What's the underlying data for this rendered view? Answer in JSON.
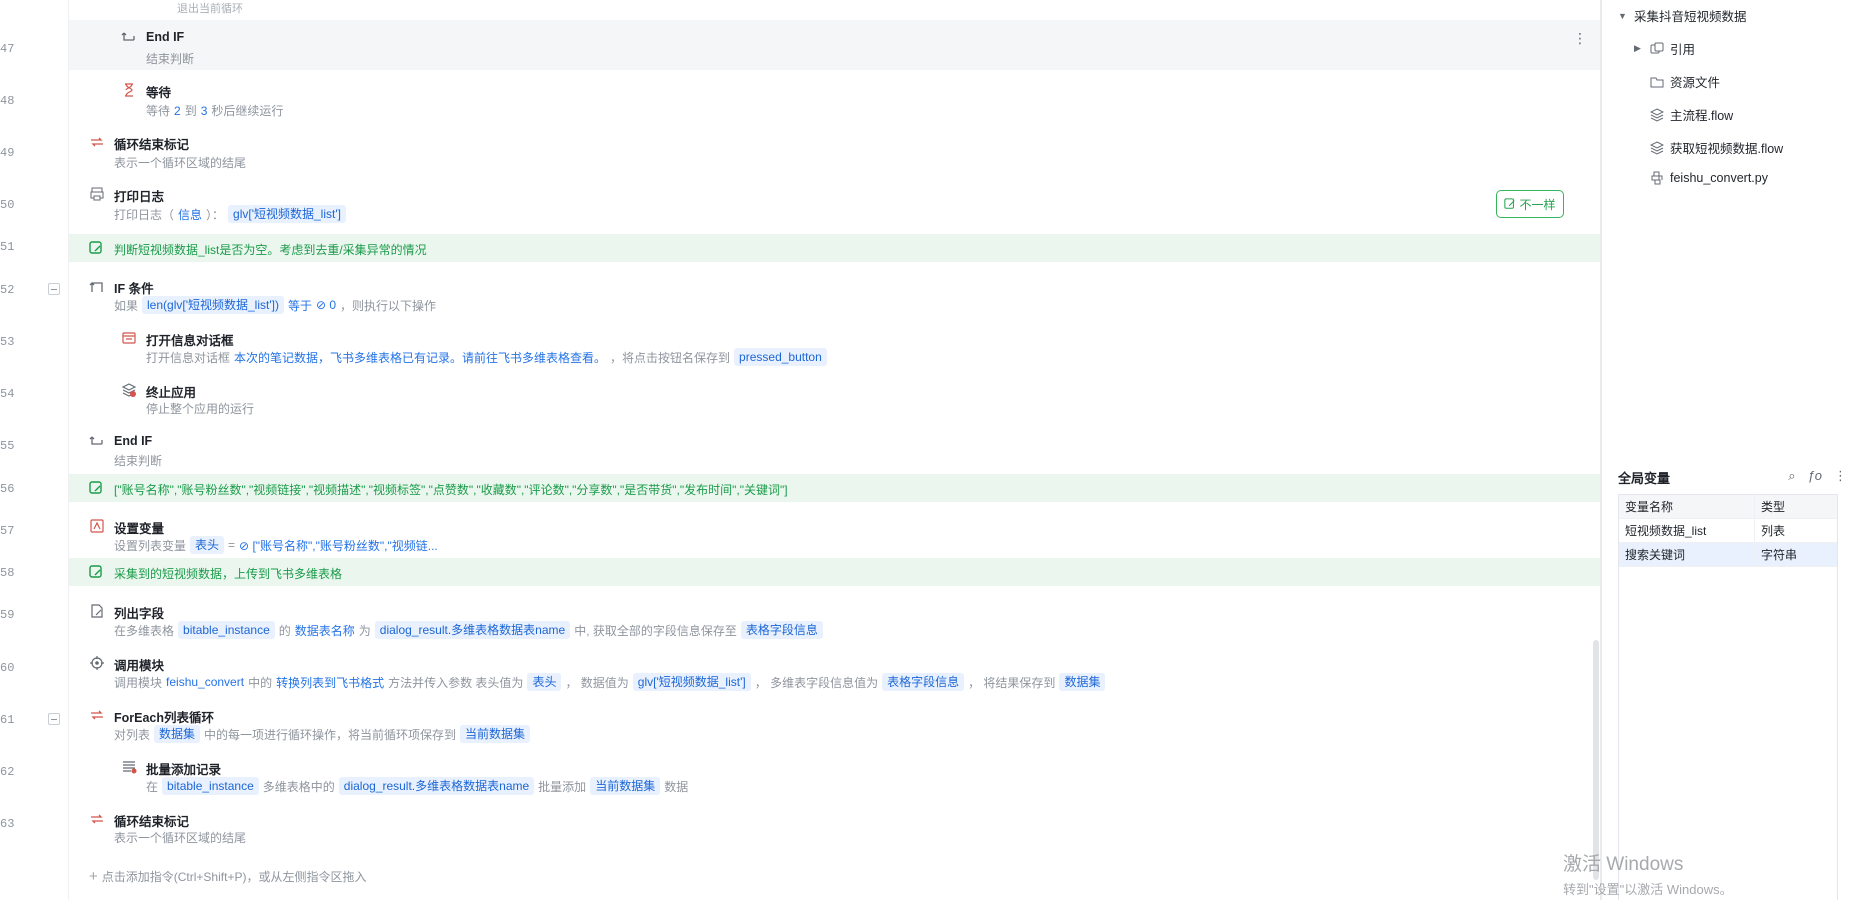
{
  "line_numbers": [
    "47",
    "48",
    "49",
    "50",
    "51",
    "52",
    "53",
    "54",
    "55",
    "56",
    "57",
    "58",
    "59",
    "60",
    "61",
    "62",
    "63"
  ],
  "top_cut_text": "退出当前循环",
  "rows": {
    "end_if_1": {
      "title": "End IF",
      "desc": "结束判断"
    },
    "wait": {
      "title": "等待",
      "p1": "等待",
      "v1": "2",
      "p2": "到",
      "v2": "3",
      "p3": "秒后继续运行"
    },
    "loop_end_1": {
      "title": "循环结束标记",
      "desc": "表示一个循环区域的结尾"
    },
    "print_log": {
      "title": "打印日志",
      "p1": "打印日志（",
      "level": "信息",
      "p2": "）：",
      "chip": "glv['短视频数据_list']"
    },
    "note_1": "判断短视频数据_list是否为空。考虑到去重/采集异常的情况",
    "if_cond": {
      "title": "IF 条件",
      "p1": "如果",
      "chip": "len(glv['短视频数据_list'])",
      "op": "等于",
      "val": "0",
      "p2": "，则执行以下操作"
    },
    "open_dialog": {
      "title": "打开信息对话框",
      "p1": "打开信息对话框",
      "msg": "本次的笔记数据，飞书多维表格已有记录。请前往飞书多维表格查看。",
      "p2": "，将点击按钮名保存到",
      "chip": "pressed_button"
    },
    "terminate": {
      "title": "终止应用",
      "desc": "停止整个应用的运行"
    },
    "end_if_2": {
      "title": "End IF",
      "desc": "结束判断"
    },
    "note_2": "[\"账号名称\",\"账号粉丝数\",\"视频链接\",\"视频描述\",\"视频标签\",\"点赞数\",\"收藏数\",\"评论数\",\"分享数\",\"是否带货\",\"发布时间\",\"关键词\"]",
    "set_var": {
      "title": "设置变量",
      "p1": "设置列表变量",
      "chip": "表头",
      "p2": "=",
      "val": "[\"账号名称\",\"账号粉丝数\",\"视频链..."
    },
    "note_3": "采集到的短视频数据，上传到飞书多维表格",
    "list_fields": {
      "title": "列出字段",
      "p1": "在多维表格",
      "chip1": "bitable_instance",
      "p2": "的",
      "k1": "数据表名称",
      "p3": "为",
      "chip2": "dialog_result.多维表格数据表name",
      "p4": "中, 获取全部的字段信息保存至",
      "chip3": "表格字段信息"
    },
    "call_module": {
      "title": "调用模块",
      "p1": "调用模块",
      "k1": "feishu_convert",
      "p2": "中的",
      "k2": "转换列表到飞书格式",
      "p3": "方法并传入参数 表头值为",
      "chip1": "表头",
      "p4": "，  数据值为",
      "chip2": "glv['短视频数据_list']",
      "p5": "，  多维表字段信息值为",
      "chip3": "表格字段信息",
      "p6": "，  将结果保存到",
      "chip4": "数据集"
    },
    "foreach": {
      "title": "ForEach列表循环",
      "p1": "对列表",
      "chip1": "数据集",
      "p2": "中的每一项进行循环操作，将当前循环项保存到",
      "chip2": "当前数据集"
    },
    "batch_add": {
      "title": "批量添加记录",
      "p1": "在",
      "chip1": "bitable_instance",
      "p2": "多维表格中的",
      "chip2": "dialog_result.多维表格数据表name",
      "p3": "批量添加",
      "chip3": "当前数据集",
      "p4": "数据"
    },
    "loop_end_2": {
      "title": "循环结束标记",
      "desc": "表示一个循环区域的结尾"
    }
  },
  "diff_badge": "不一样",
  "add_hint": "点击添加指令(Ctrl+Shift+P)，或从左侧指令区拖入",
  "add_plus": "+",
  "more_icon": "⋮",
  "tree": {
    "root": "采集抖音短视频数据",
    "items": [
      "引用",
      "资源文件",
      "主流程.flow",
      "获取短视频数据.flow",
      "feishu_convert.py"
    ]
  },
  "global_vars": {
    "title": "全局变量",
    "col_name": "变量名称",
    "col_type": "类型",
    "rows": [
      {
        "name": "短视频数据_list",
        "type": "列表"
      },
      {
        "name": "搜索关键词",
        "type": "字符串"
      }
    ]
  },
  "watermark": {
    "line1": "激活 Windows",
    "line2": "转到\"设置\"以激活 Windows。"
  },
  "colors": {
    "accent": "#2473e6",
    "note_green": "#1a9b4a",
    "note_bg": "#ebf7ee",
    "chip_bg": "#e8f1fd",
    "badge_green": "#34b45c"
  }
}
